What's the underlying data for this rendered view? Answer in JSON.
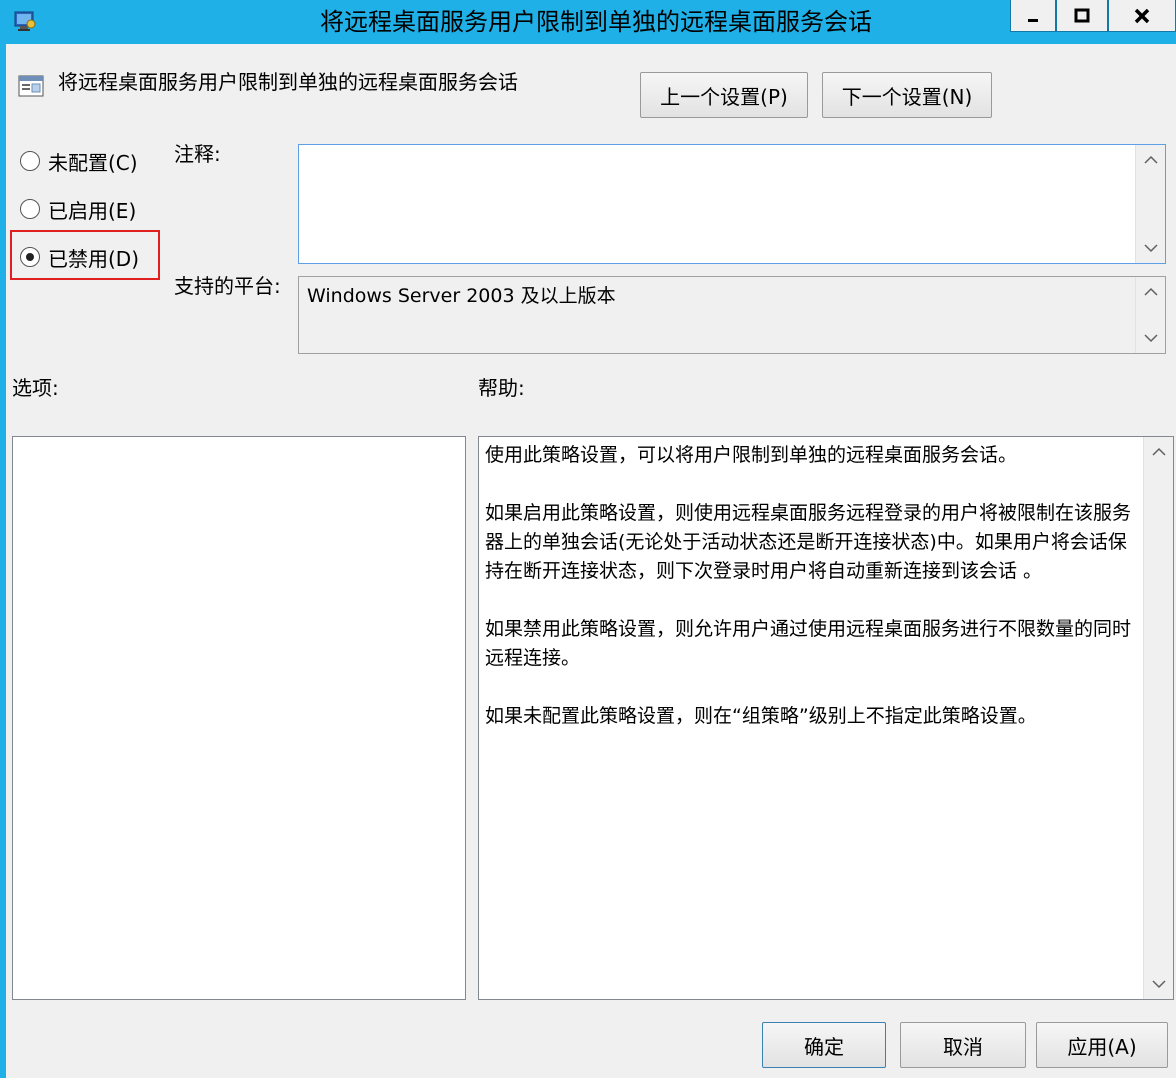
{
  "window": {
    "title": "将远程桌面服务用户限制到单独的远程桌面服务会话",
    "controls": {
      "minimize": "minimize",
      "maximize": "maximize",
      "close": "close"
    },
    "accent_color": "#1eb0e6"
  },
  "header": {
    "setting_name": "将远程桌面服务用户限制到单独的远程桌面服务会话",
    "prev_button": "上一个设置(P)",
    "next_button": "下一个设置(N)"
  },
  "state": {
    "options": [
      {
        "label": "未配置(C)",
        "checked": false
      },
      {
        "label": "已启用(E)",
        "checked": false
      },
      {
        "label": "已禁用(D)",
        "checked": true
      }
    ],
    "highlight_color": "#e02020"
  },
  "comment": {
    "label": "注释:",
    "value": ""
  },
  "platform": {
    "label": "支持的平台:",
    "value": "Windows Server 2003 及以上版本"
  },
  "options_panel": {
    "label": "选项:"
  },
  "help_panel": {
    "label": "帮助:",
    "paragraphs": [
      "使用此策略设置，可以将用户限制到单独的远程桌面服务会话。",
      "如果启用此策略设置，则使用远程桌面服务远程登录的用户将被限制在该服务器上的单独会话(无论处于活动状态还是断开连接状态)中。如果用户将会话保持在断开连接状态，则下次登录时用户将自动重新连接到该会话 。",
      "如果禁用此策略设置，则允许用户通过使用远程桌面服务进行不限数量的同时远程连接。",
      "如果未配置此策略设置，则在“组策略”级别上不指定此策略设置。"
    ]
  },
  "footer": {
    "ok": "确定",
    "cancel": "取消",
    "apply": "应用(A)"
  },
  "icons": {
    "app": "policy-app-icon",
    "setting": "policy-setting-icon"
  }
}
